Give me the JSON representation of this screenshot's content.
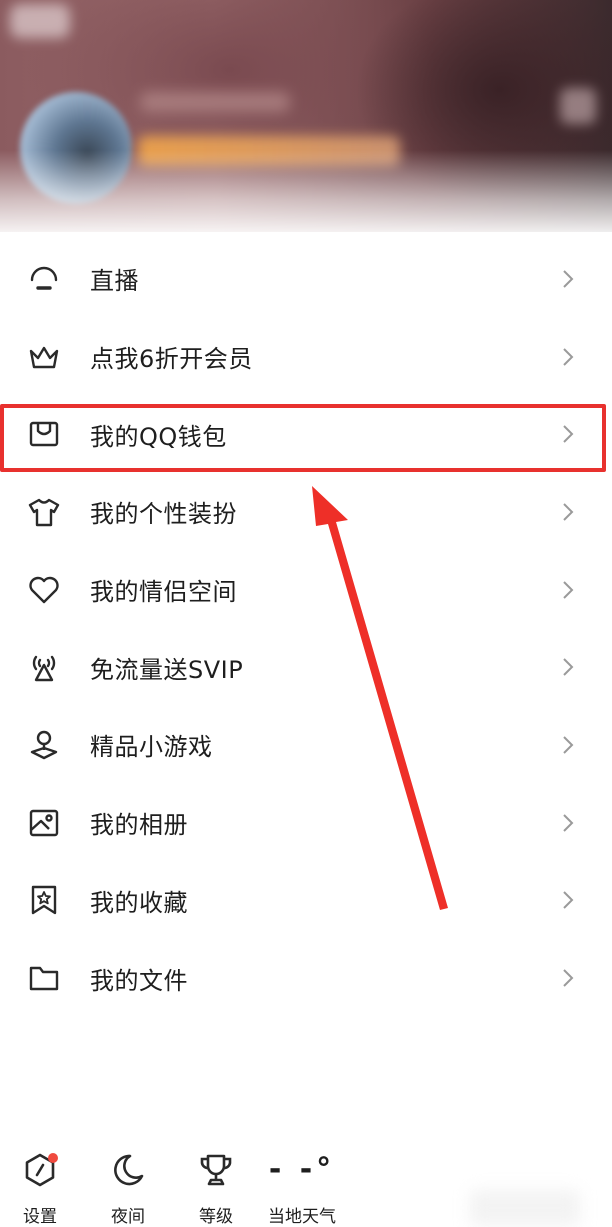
{
  "menu": {
    "items": [
      {
        "label": "直播",
        "icon": "live-icon"
      },
      {
        "label": "点我6折开会员",
        "icon": "crown-icon"
      },
      {
        "label": "我的QQ钱包",
        "icon": "wallet-icon"
      },
      {
        "label": "我的个性装扮",
        "icon": "tshirt-icon"
      },
      {
        "label": "我的情侣空间",
        "icon": "heart-icon"
      },
      {
        "label": "免流量送SVIP",
        "icon": "signal-tower-icon"
      },
      {
        "label": "精品小游戏",
        "icon": "game-icon"
      },
      {
        "label": "我的相册",
        "icon": "album-icon"
      },
      {
        "label": "我的收藏",
        "icon": "bookmark-star-icon"
      },
      {
        "label": "我的文件",
        "icon": "folder-icon"
      }
    ]
  },
  "bottom_bar": {
    "settings_label": "设置",
    "night_label": "夜间",
    "level_label": "等级",
    "weather_label": "当地天气",
    "weather_temp": "- -°"
  },
  "colors": {
    "highlight": "#e8312e",
    "badge": "#f04a3f",
    "text": "#1e1e1e"
  }
}
